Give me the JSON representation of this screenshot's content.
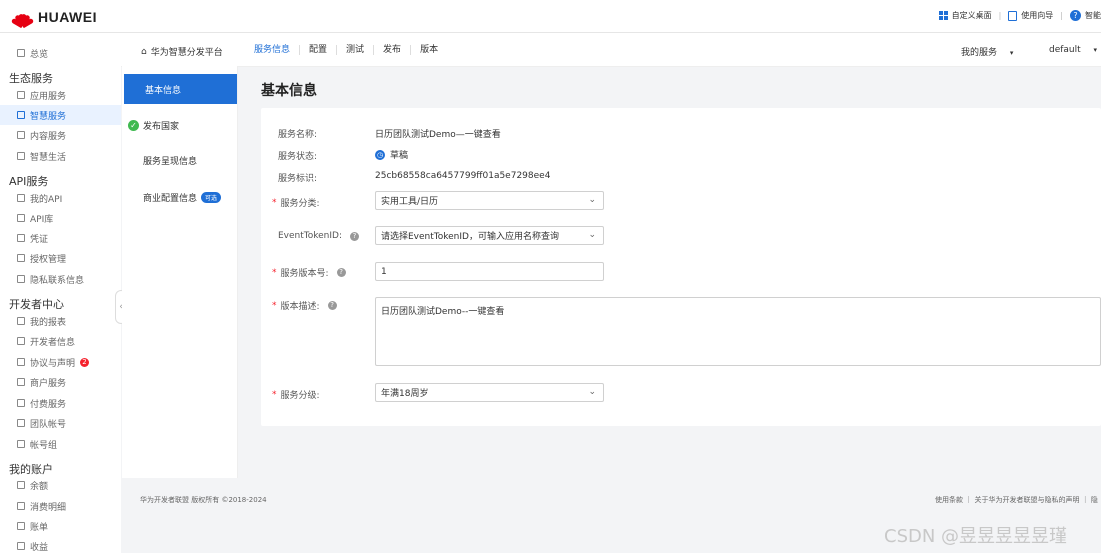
{
  "topbar": {
    "brand": "HUAWEI",
    "customize_desktop": "自定义桌面",
    "user_guide": "使用向导",
    "smart": "智能"
  },
  "sidebar": {
    "overview": "总览",
    "eco_heading": "生态服务",
    "app_service": "应用服务",
    "smart_service": "智慧服务",
    "content_service": "内容服务",
    "smart_life": "智慧生活",
    "api_heading": "API服务",
    "my_api": "我的API",
    "api_lib": "API库",
    "credential": "凭证",
    "auth_manage": "授权管理",
    "privacy_contact": "隐私联系信息",
    "dev_heading": "开发者中心",
    "my_reports": "我的报表",
    "dev_info": "开发者信息",
    "agreements": "协议与声明",
    "agreements_badge": "2",
    "merchant": "商户服务",
    "paid": "付费服务",
    "team": "团队帐号",
    "account_group": "帐号组",
    "acct_heading": "我的账户",
    "balance": "余额",
    "consumption": "消费明细",
    "bills": "账单",
    "income": "收益"
  },
  "subnav": {
    "platform": "华为智慧分发平台",
    "tabs": [
      "服务信息",
      "配置",
      "测试",
      "发布",
      "版本"
    ],
    "my_services": "我的服务",
    "env": "default"
  },
  "steps": {
    "basic": "基本信息",
    "countries": "发布国家",
    "display": "服务呈现信息",
    "commerce": "商业配置信息",
    "optional": "可选"
  },
  "form": {
    "title": "基本信息",
    "name_label": "服务名称:",
    "name_value": "日历团队测试Demo—一键查看",
    "status_label": "服务状态:",
    "status_value": "草稿",
    "id_label": "服务标识:",
    "id_value": "25cb68558ca6457799ff01a5e7298ee4",
    "category_label": "服务分类:",
    "category_value": "实用工具/日历",
    "token_label": "EventTokenID:",
    "token_placeholder": "请选择EventTokenID，可输入应用名称查询",
    "version_label": "服务版本号:",
    "version_value": "1",
    "desc_label": "版本描述:",
    "desc_value": "日历团队测试Demo--一键查看",
    "rating_label": "服务分级:",
    "rating_value": "年满18周岁"
  },
  "footer": {
    "copyright": "华为开发者联盟 版权所有 ©2018-2024",
    "links": "使用条款 ｜ 关于华为开发者联盟与隐私的声明 ｜ 隐"
  },
  "watermark": "CSDN @昱昱昱昱昱瑾",
  "colors": {
    "accent": "#1f6fd6",
    "brand_red": "#e60012",
    "success": "#3fb950"
  }
}
